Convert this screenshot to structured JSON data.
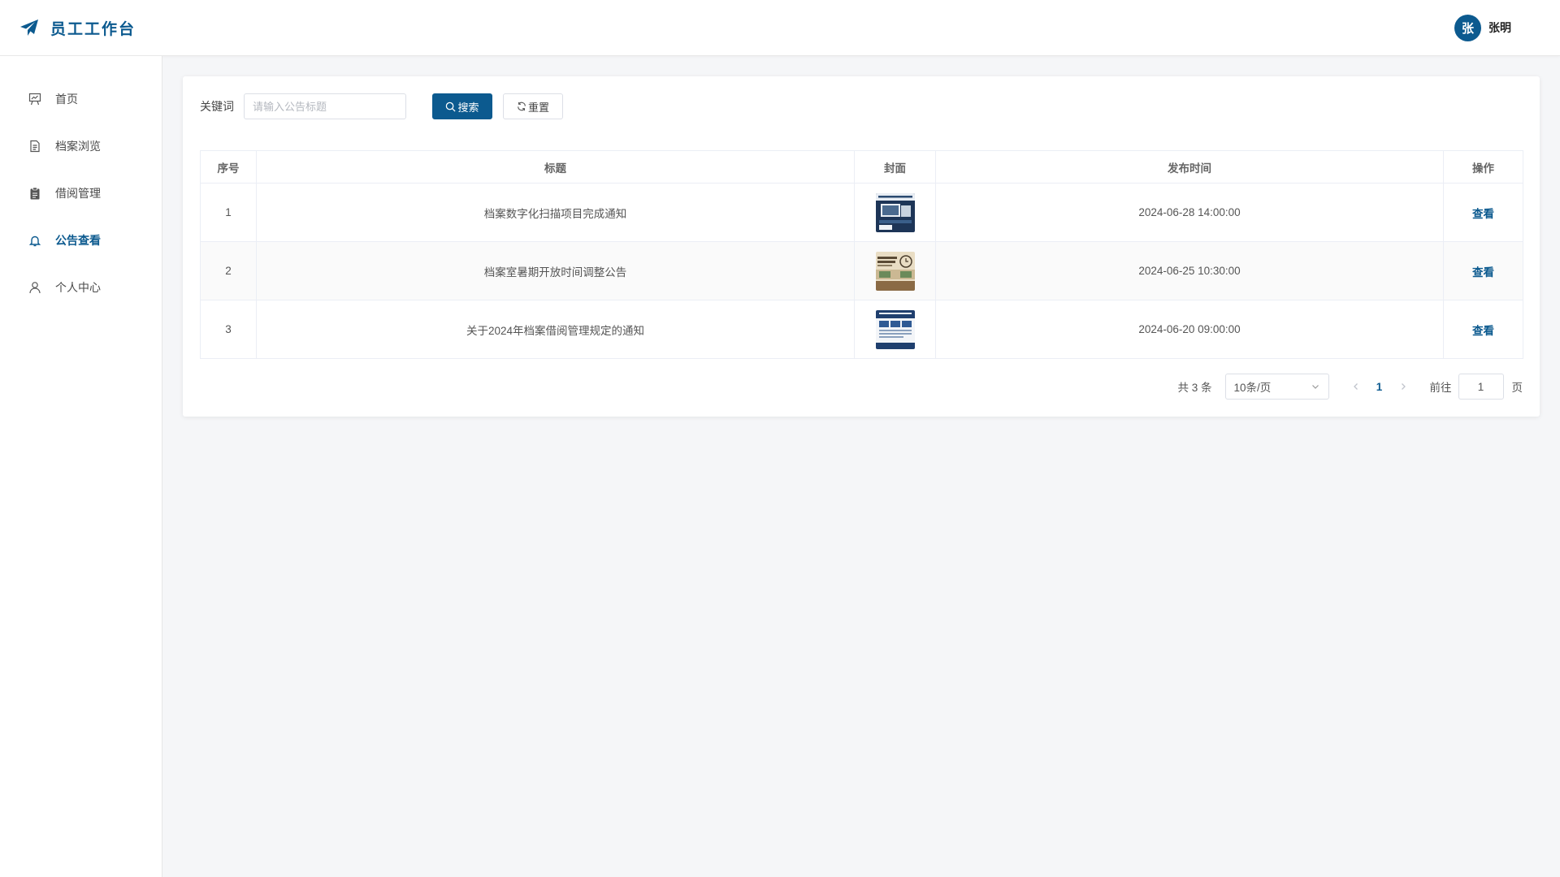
{
  "header": {
    "app_title": "员工工作台",
    "brand_icon": "paper-plane-icon",
    "user": {
      "avatar_text": "张",
      "name": "张明"
    }
  },
  "colors": {
    "primary": "#0c5a8f",
    "background": "#f5f6f8"
  },
  "sidebar": {
    "items": [
      {
        "label": "首页",
        "icon": "presentation-icon",
        "active": false
      },
      {
        "label": "档案浏览",
        "icon": "document-icon",
        "active": false
      },
      {
        "label": "借阅管理",
        "icon": "clipboard-icon",
        "active": false
      },
      {
        "label": "公告查看",
        "icon": "bell-icon",
        "active": true
      },
      {
        "label": "个人中心",
        "icon": "user-icon",
        "active": false
      }
    ]
  },
  "search": {
    "keyword_label": "关键词",
    "placeholder": "请输入公告标题",
    "value": "",
    "search_label": "搜索",
    "reset_label": "重置"
  },
  "table": {
    "columns": [
      "序号",
      "标题",
      "封面",
      "发布时间",
      "操作"
    ],
    "rows": [
      {
        "index": "1",
        "title": "档案数字化扫描项目完成通知",
        "cover": "project-completed-cover",
        "published": "2024-06-28 14:00:00",
        "action": "查看"
      },
      {
        "index": "2",
        "title": "档案室暑期开放时间调整公告",
        "cover": "opening-hours-cover",
        "published": "2024-06-25 10:30:00",
        "action": "查看"
      },
      {
        "index": "3",
        "title": "关于2024年档案借阅管理规定的通知",
        "cover": "regulations-cover",
        "published": "2024-06-20 09:00:00",
        "action": "查看"
      }
    ]
  },
  "pagination": {
    "total_text": "共 3 条",
    "page_size": "10条/页",
    "current_page": "1",
    "goto_label": "前往",
    "goto_value": "1",
    "page_suffix": "页"
  }
}
